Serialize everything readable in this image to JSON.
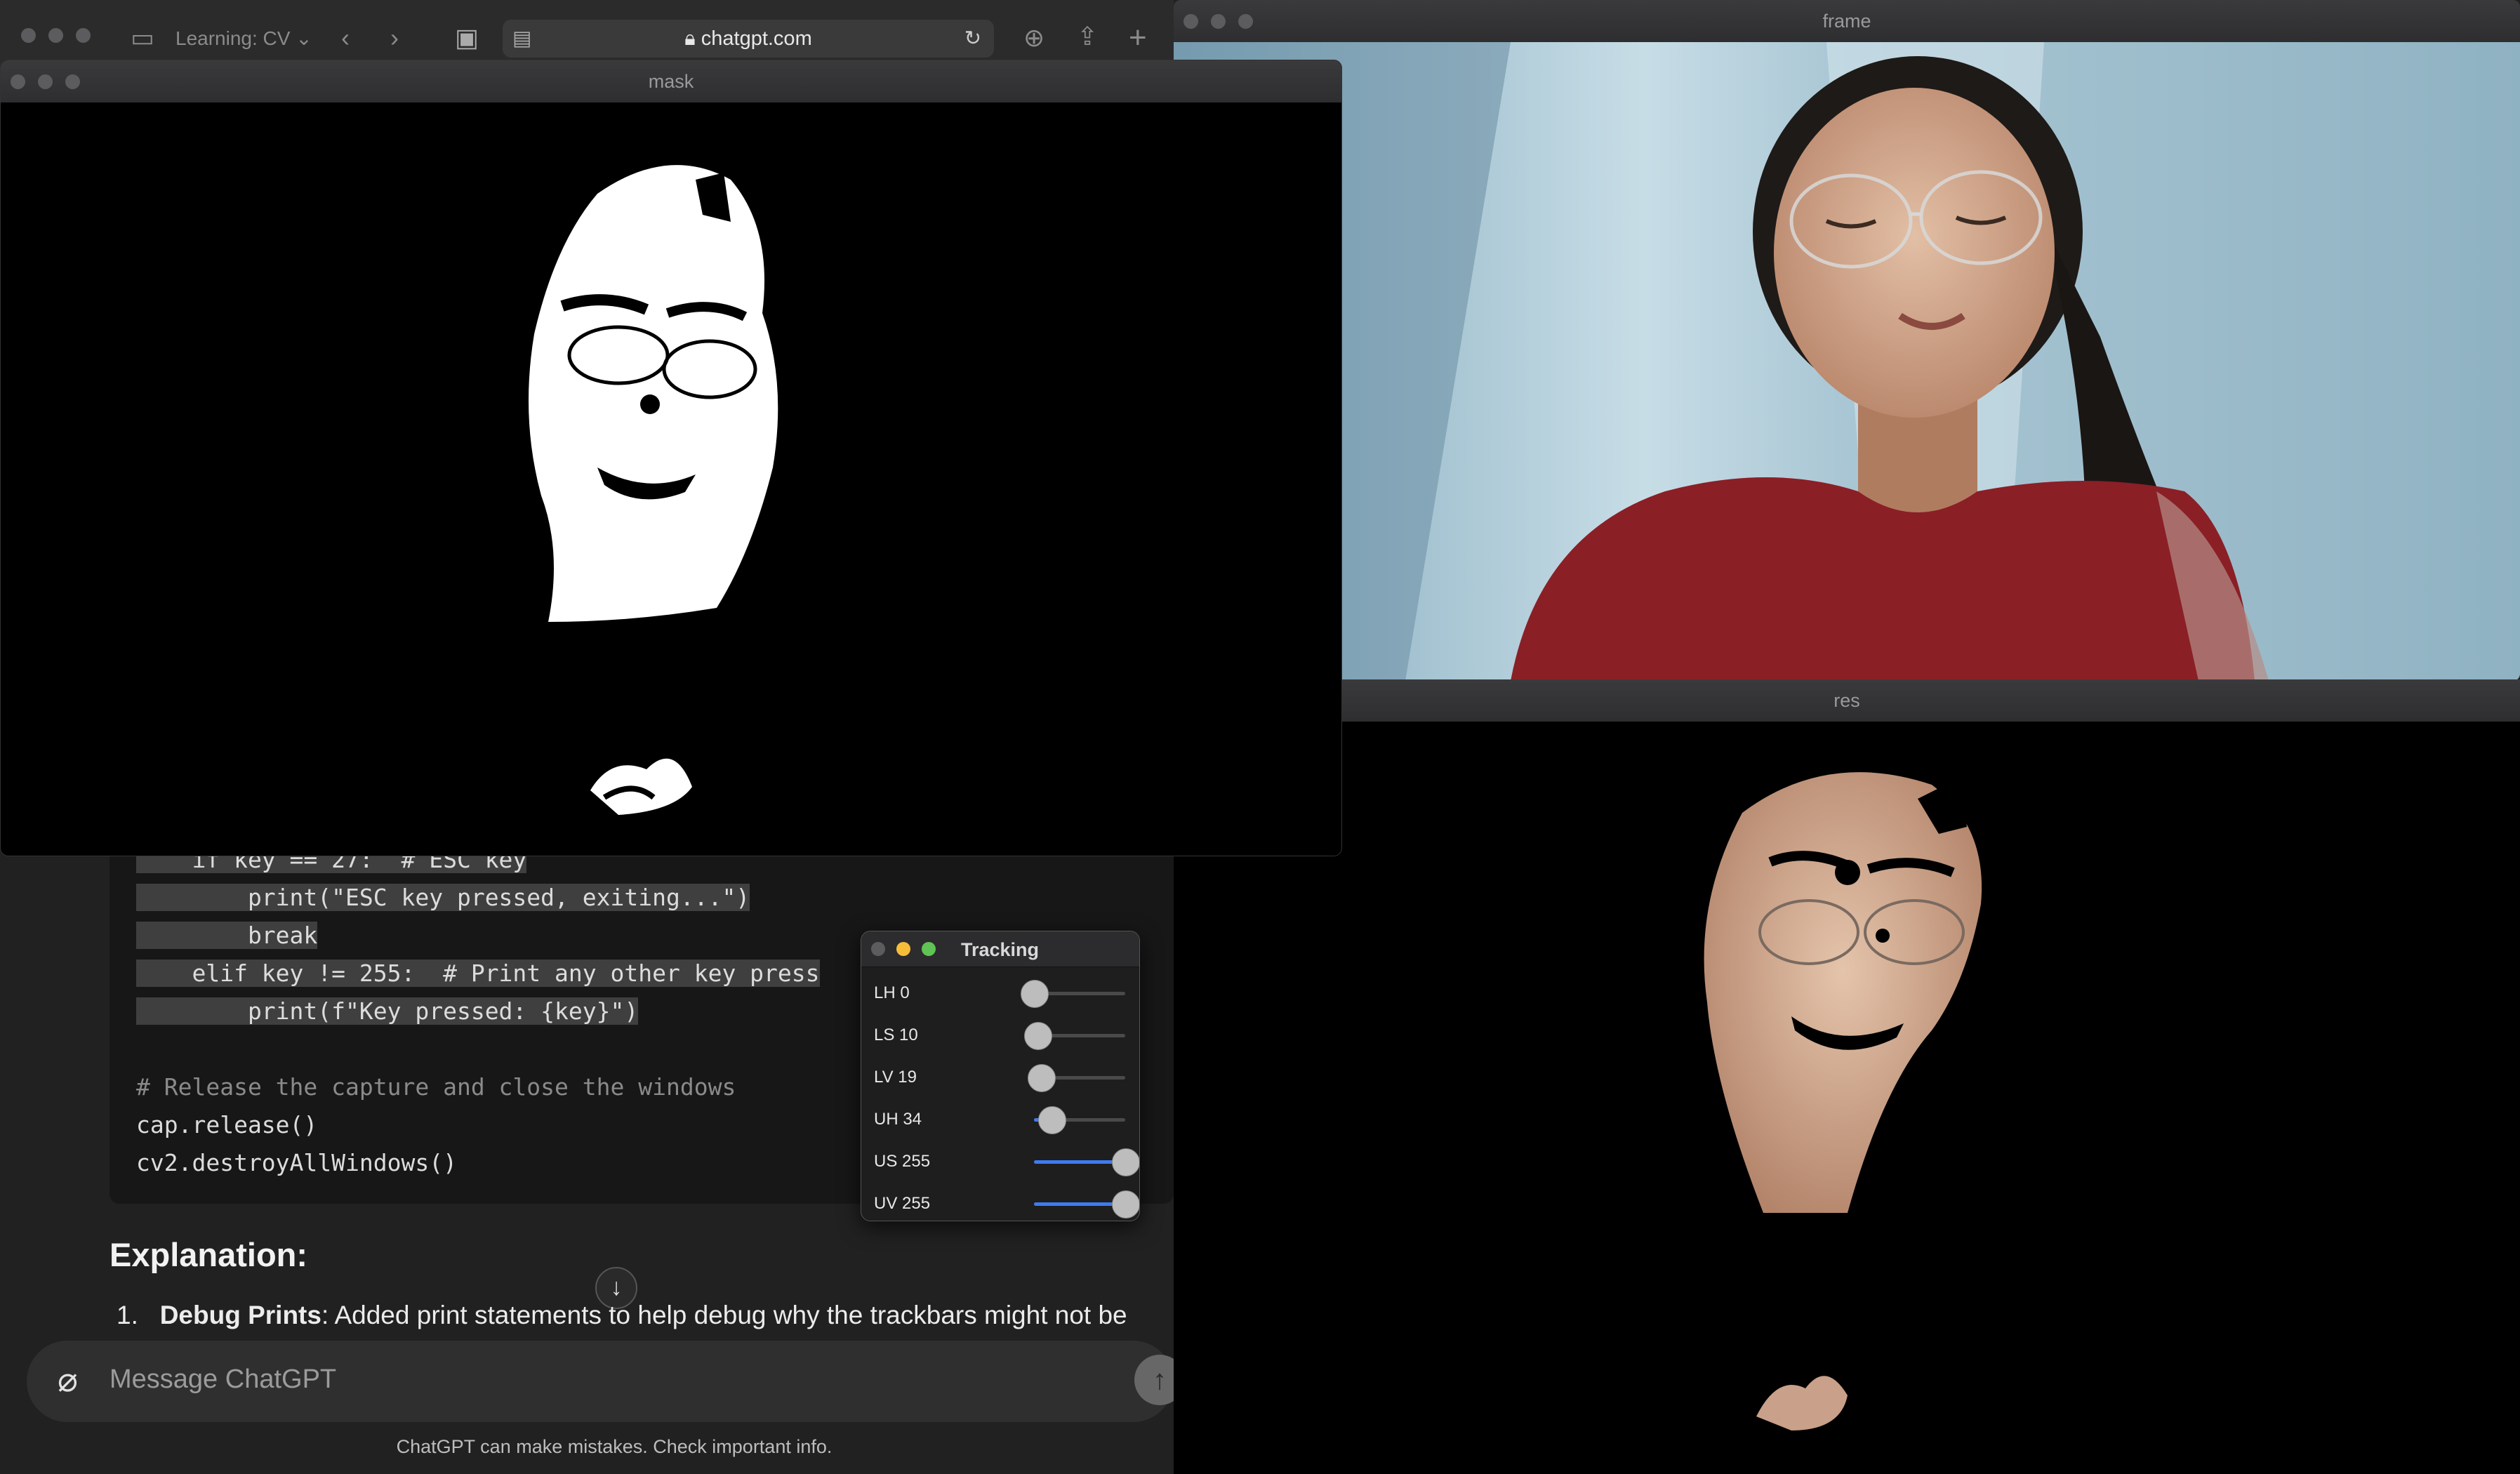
{
  "browser": {
    "tab_group": "Learning: CV",
    "url": "chatgpt.com",
    "code_lines": [
      {
        "text": "    if key == 27:  # ESC key",
        "highlight": true
      },
      {
        "text": "        print(\"ESC key pressed, exiting...\")",
        "highlight": true
      },
      {
        "text": "        break",
        "highlight": true
      },
      {
        "text": "    elif key != 255:  # Print any other key press",
        "highlight": true
      },
      {
        "text": "        print(f\"Key pressed: {key}\")",
        "highlight": true
      },
      {
        "text": "",
        "highlight": false
      },
      {
        "text": "# Release the capture and close the windows",
        "highlight": false,
        "comment": true
      },
      {
        "text": "cap.release()",
        "highlight": false
      },
      {
        "text": "cv2.destroyAllWindows()",
        "highlight": false
      }
    ],
    "explanation_heading": "Explanation:",
    "list_number": "1.",
    "list_bold": "Debug Prints",
    "list_text": ": Added print statements to help debug why the trackbars might not be",
    "composer_placeholder": "Message ChatGPT",
    "disclaimer": "ChatGPT can make mistakes. Check important info."
  },
  "windows": {
    "mask_title": "mask",
    "frame_title": "frame",
    "res_title": "res",
    "tracking_title": "Tracking"
  },
  "tracking": [
    {
      "label": "LH 0",
      "value": 0,
      "max": 179
    },
    {
      "label": "LS 10",
      "value": 10,
      "max": 255
    },
    {
      "label": "LV 19",
      "value": 19,
      "max": 255
    },
    {
      "label": "UH 34",
      "value": 34,
      "max": 179
    },
    {
      "label": "US 255",
      "value": 255,
      "max": 255
    },
    {
      "label": "UV 255",
      "value": 255,
      "max": 255
    }
  ],
  "colors": {
    "slider_fill": "#3e7bf0",
    "frame_wall": "#a9c6d4",
    "shirt": "#8b1f26",
    "skin": "#d9b49a"
  }
}
